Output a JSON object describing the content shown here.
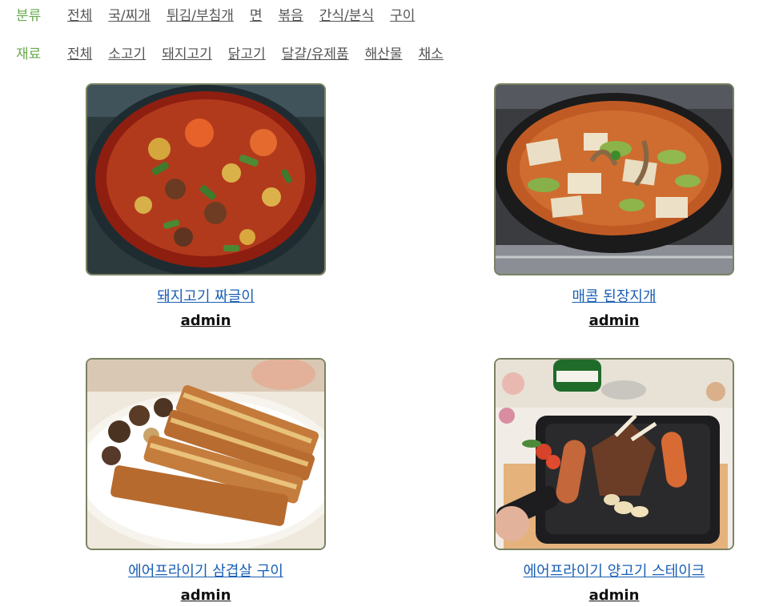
{
  "filters": {
    "category": {
      "label": "분류",
      "options": [
        "전체",
        "국/찌개",
        "튀김/부침개",
        "면",
        "볶음",
        "간식/분식",
        "구이"
      ]
    },
    "ingredient": {
      "label": "재료",
      "options": [
        "전체",
        "소고기",
        "돼지고기",
        "닭고기",
        "달걀/유제품",
        "해산물",
        "채소"
      ]
    }
  },
  "recipes": [
    {
      "title": "돼지고기 짜글이",
      "author": "admin",
      "image": "pork-jjageuli-photo"
    },
    {
      "title": "매콤 된장지개",
      "author": "admin",
      "image": "spicy-doenjang-stew-photo"
    },
    {
      "title": "에어프라이기 삼겹살 구이",
      "author": "admin",
      "image": "air-fryer-pork-belly-photo"
    },
    {
      "title": "에어프라이기 양고기 스테이크",
      "author": "admin",
      "image": "air-fryer-lamb-steak-photo"
    }
  ],
  "colors": {
    "filter_label": "#6aa84f",
    "recipe_link": "#1a5fb4",
    "thumb_border": "#7a8263"
  }
}
